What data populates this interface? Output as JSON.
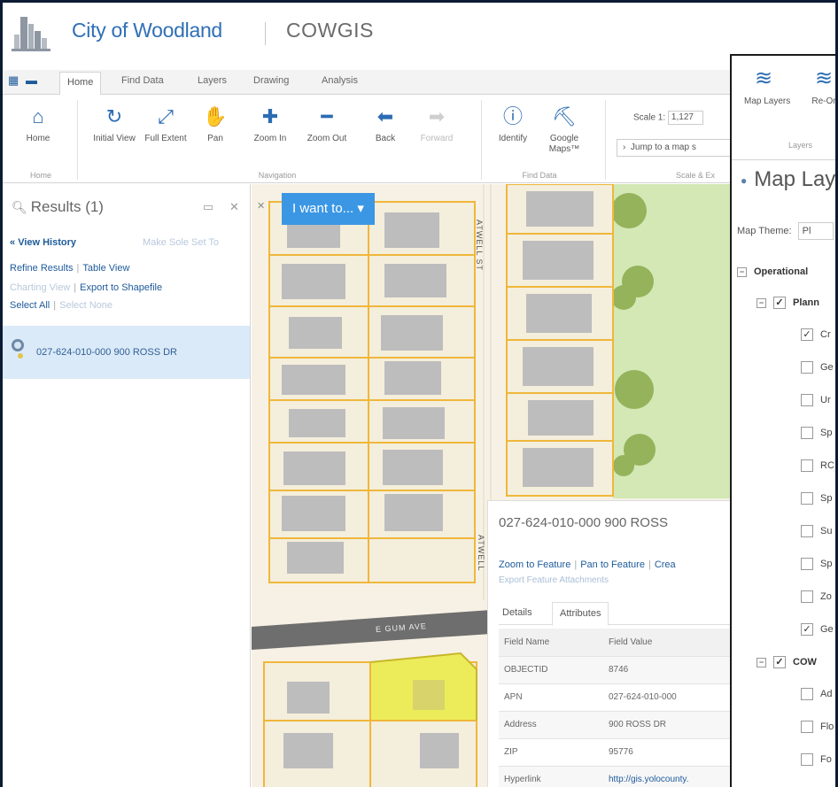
{
  "header": {
    "city_name": "City of Woodland",
    "app_name": "COWGIS"
  },
  "ribbon": {
    "tabs": [
      "Home",
      "Find Data",
      "Layers",
      "Drawing",
      "Analysis"
    ],
    "buttons": {
      "home": "Home",
      "initial_view": "Initial View",
      "full_extent": "Full Extent",
      "pan": "Pan",
      "zoom_in": "Zoom In",
      "zoom_out": "Zoom Out",
      "back": "Back",
      "forward": "Forward",
      "identify": "Identify",
      "google_maps": "Google Maps™"
    },
    "groups": {
      "home": "Home",
      "navigation": "Navigation",
      "find_data": "Find Data",
      "scale": "Scale & Ex"
    },
    "scale_label": "Scale 1:",
    "scale_value": "1,127",
    "jump_placeholder": "Jump to a map s"
  },
  "results": {
    "title": "Results (1)",
    "view_history": "View History",
    "make_sole_set": "Make Sole Set To",
    "refine_results": "Refine Results",
    "table_view": "Table View",
    "charting_view": "Charting View",
    "export_shapefile": "Export to Shapefile",
    "select_all": "Select All",
    "select_none": "Select None",
    "item": "027-624-010-000 900 ROSS DR"
  },
  "map": {
    "i_want_to": "I want to...",
    "streets": {
      "atwell_top": "ATWELL ST",
      "atwell_bottom": "ATWELL",
      "gum_ave": "E GUM AVE"
    }
  },
  "feature_details": {
    "title": "027-624-010-000 900 ROSS",
    "zoom_to_feature": "Zoom to Feature",
    "pan_to_feature": "Pan to Feature",
    "create": "Crea",
    "export_attachments": "Export Feature Attachments",
    "tabs": [
      "Details",
      "Attributes"
    ],
    "table_headers": [
      "Field Name",
      "Field Value"
    ],
    "rows": [
      [
        "OBJECTID",
        "8746"
      ],
      [
        "APN",
        "027-624-010-000"
      ],
      [
        "Address",
        "900 ROSS DR"
      ],
      [
        "ZIP",
        "95776"
      ],
      [
        "Hyperlink",
        "http://gis.yolocounty."
      ]
    ]
  },
  "map_layers": {
    "buttons": {
      "map_layers": "Map Layers",
      "reorder": "Re-Or"
    },
    "group": "Layers",
    "title": "Map Lay",
    "theme_label": "Map Theme:",
    "theme_value": "Pl",
    "operational": "Operational",
    "planning": "Plann",
    "planning_items": [
      {
        "label": "Cr",
        "checked": true
      },
      {
        "label": "Ge",
        "checked": false
      },
      {
        "label": "Ur",
        "checked": false
      },
      {
        "label": "Sp",
        "checked": false
      },
      {
        "label": "RC",
        "checked": false
      },
      {
        "label": "Sp",
        "checked": false
      },
      {
        "label": "Su",
        "checked": false
      },
      {
        "label": "Sp",
        "checked": false
      },
      {
        "label": "Zo",
        "checked": false
      },
      {
        "label": "Ge",
        "checked": true
      }
    ],
    "cowgis": "COW",
    "cowgis_items": [
      {
        "label": "Ad",
        "checked": false
      },
      {
        "label": "Flo",
        "checked": false
      },
      {
        "label": "Fo",
        "checked": false
      }
    ]
  },
  "colors": {
    "accent": "#2c6cb3",
    "link": "#1d5a9a",
    "i_want_to_bg": "#3b97e4",
    "selected_parcel": "#ecec5a",
    "parcel_line": "#f0b73a",
    "park": "#d3e8b5"
  }
}
